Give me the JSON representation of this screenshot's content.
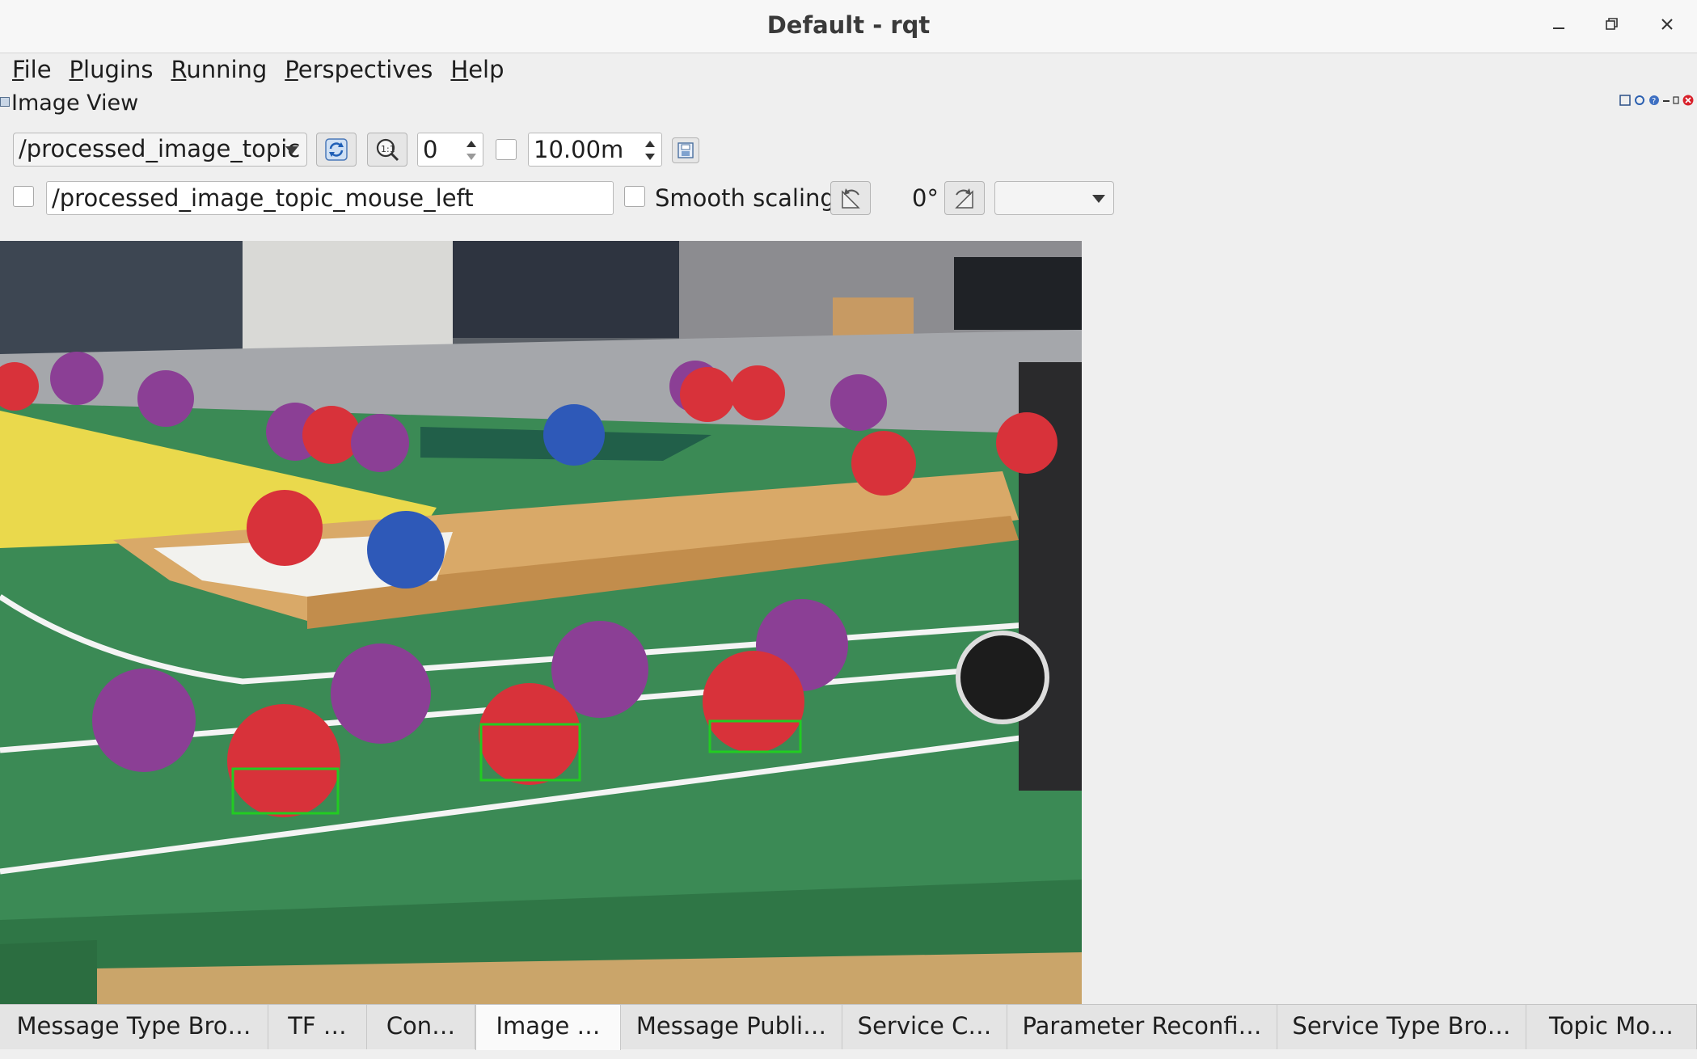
{
  "window": {
    "title": "Default - rqt"
  },
  "menu": [
    {
      "mnemonic": "F",
      "rest": "ile"
    },
    {
      "mnemonic": "P",
      "rest": "lugins"
    },
    {
      "mnemonic": "R",
      "rest": "unning"
    },
    {
      "mnemonic": "P",
      "rest": "erspectives"
    },
    {
      "mnemonic": "H",
      "rest": "elp"
    }
  ],
  "dock": {
    "title": "Image View"
  },
  "toolbar": {
    "topic": "/processed_image_topic",
    "zoom_value": "0",
    "duration_value": "10.00m",
    "mouse_topic": "/processed_image_topic_mouse_left",
    "smooth_scaling_label": "Smooth scaling",
    "rotation_value": "0°",
    "rotation_combo_value": ""
  },
  "tabs": [
    {
      "label": "Message Type Bro…",
      "active": false
    },
    {
      "label": "TF …",
      "active": false
    },
    {
      "label": "Con…",
      "active": false
    },
    {
      "label": "Image …",
      "active": true
    },
    {
      "label": "Message Publi…",
      "active": false
    },
    {
      "label": "Service C…",
      "active": false
    },
    {
      "label": "Parameter Reconfi…",
      "active": false
    },
    {
      "label": "Service Type Bro…",
      "active": false
    },
    {
      "label": "Topic Mo…",
      "active": false
    }
  ],
  "icons": {
    "window": [
      "minimize-icon",
      "maximize-icon",
      "close-icon"
    ],
    "toolbar": [
      "refresh-icon",
      "zoom-fit-icon",
      "save-image-icon",
      "rotate-left-icon",
      "rotate-right-icon"
    ]
  },
  "colors": {
    "detection_box": "#22cc22",
    "field_green": "#3b8a55",
    "ball_red": "#d8323a",
    "ball_purple": "#8b3f95",
    "ball_blue": "#2e59b8"
  }
}
